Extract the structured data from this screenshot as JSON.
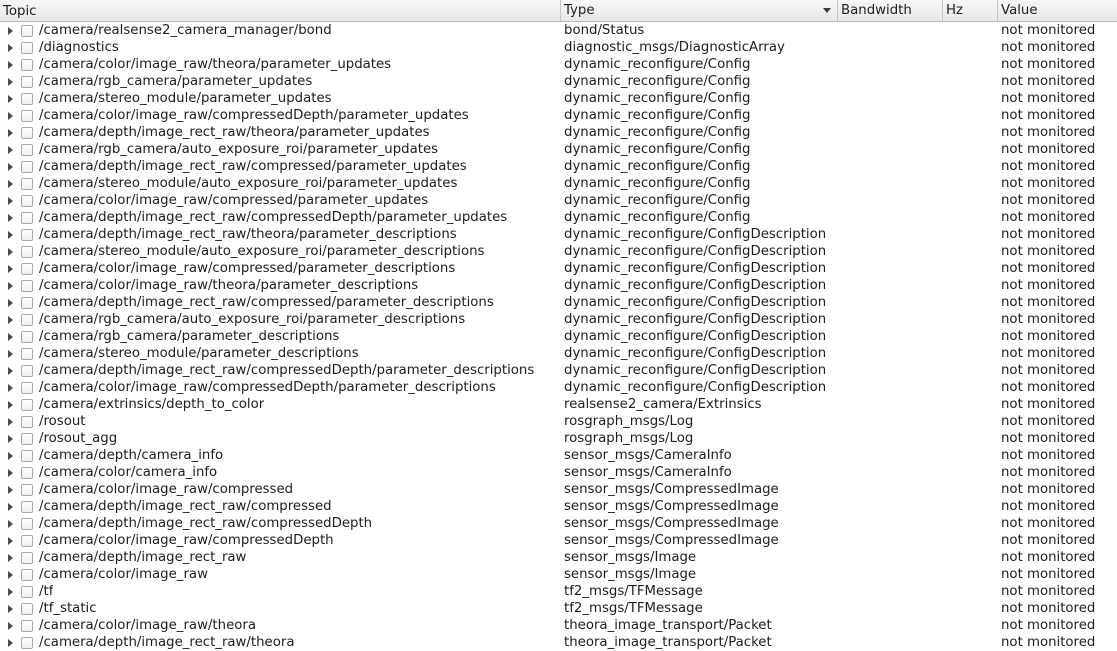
{
  "header": {
    "topic": "Topic",
    "type": "Type",
    "bandwidth": "Bandwidth",
    "hz": "Hz",
    "value": "Value"
  },
  "rows": [
    {
      "topic": "/camera/realsense2_camera_manager/bond",
      "type": "bond/Status",
      "value": "not monitored"
    },
    {
      "topic": "/diagnostics",
      "type": "diagnostic_msgs/DiagnosticArray",
      "value": "not monitored"
    },
    {
      "topic": "/camera/color/image_raw/theora/parameter_updates",
      "type": "dynamic_reconfigure/Config",
      "value": "not monitored"
    },
    {
      "topic": "/camera/rgb_camera/parameter_updates",
      "type": "dynamic_reconfigure/Config",
      "value": "not monitored"
    },
    {
      "topic": "/camera/stereo_module/parameter_updates",
      "type": "dynamic_reconfigure/Config",
      "value": "not monitored"
    },
    {
      "topic": "/camera/color/image_raw/compressedDepth/parameter_updates",
      "type": "dynamic_reconfigure/Config",
      "value": "not monitored"
    },
    {
      "topic": "/camera/depth/image_rect_raw/theora/parameter_updates",
      "type": "dynamic_reconfigure/Config",
      "value": "not monitored"
    },
    {
      "topic": "/camera/rgb_camera/auto_exposure_roi/parameter_updates",
      "type": "dynamic_reconfigure/Config",
      "value": "not monitored"
    },
    {
      "topic": "/camera/depth/image_rect_raw/compressed/parameter_updates",
      "type": "dynamic_reconfigure/Config",
      "value": "not monitored"
    },
    {
      "topic": "/camera/stereo_module/auto_exposure_roi/parameter_updates",
      "type": "dynamic_reconfigure/Config",
      "value": "not monitored"
    },
    {
      "topic": "/camera/color/image_raw/compressed/parameter_updates",
      "type": "dynamic_reconfigure/Config",
      "value": "not monitored"
    },
    {
      "topic": "/camera/depth/image_rect_raw/compressedDepth/parameter_updates",
      "type": "dynamic_reconfigure/Config",
      "value": "not monitored"
    },
    {
      "topic": "/camera/depth/image_rect_raw/theora/parameter_descriptions",
      "type": "dynamic_reconfigure/ConfigDescription",
      "value": "not monitored"
    },
    {
      "topic": "/camera/stereo_module/auto_exposure_roi/parameter_descriptions",
      "type": "dynamic_reconfigure/ConfigDescription",
      "value": "not monitored"
    },
    {
      "topic": "/camera/color/image_raw/compressed/parameter_descriptions",
      "type": "dynamic_reconfigure/ConfigDescription",
      "value": "not monitored"
    },
    {
      "topic": "/camera/color/image_raw/theora/parameter_descriptions",
      "type": "dynamic_reconfigure/ConfigDescription",
      "value": "not monitored"
    },
    {
      "topic": "/camera/depth/image_rect_raw/compressed/parameter_descriptions",
      "type": "dynamic_reconfigure/ConfigDescription",
      "value": "not monitored"
    },
    {
      "topic": "/camera/rgb_camera/auto_exposure_roi/parameter_descriptions",
      "type": "dynamic_reconfigure/ConfigDescription",
      "value": "not monitored"
    },
    {
      "topic": "/camera/rgb_camera/parameter_descriptions",
      "type": "dynamic_reconfigure/ConfigDescription",
      "value": "not monitored"
    },
    {
      "topic": "/camera/stereo_module/parameter_descriptions",
      "type": "dynamic_reconfigure/ConfigDescription",
      "value": "not monitored"
    },
    {
      "topic": "/camera/depth/image_rect_raw/compressedDepth/parameter_descriptions",
      "type": "dynamic_reconfigure/ConfigDescription",
      "value": "not monitored"
    },
    {
      "topic": "/camera/color/image_raw/compressedDepth/parameter_descriptions",
      "type": "dynamic_reconfigure/ConfigDescription",
      "value": "not monitored"
    },
    {
      "topic": "/camera/extrinsics/depth_to_color",
      "type": "realsense2_camera/Extrinsics",
      "value": "not monitored"
    },
    {
      "topic": "/rosout",
      "type": "rosgraph_msgs/Log",
      "value": "not monitored"
    },
    {
      "topic": "/rosout_agg",
      "type": "rosgraph_msgs/Log",
      "value": "not monitored"
    },
    {
      "topic": "/camera/depth/camera_info",
      "type": "sensor_msgs/CameraInfo",
      "value": "not monitored"
    },
    {
      "topic": "/camera/color/camera_info",
      "type": "sensor_msgs/CameraInfo",
      "value": "not monitored"
    },
    {
      "topic": "/camera/color/image_raw/compressed",
      "type": "sensor_msgs/CompressedImage",
      "value": "not monitored"
    },
    {
      "topic": "/camera/depth/image_rect_raw/compressed",
      "type": "sensor_msgs/CompressedImage",
      "value": "not monitored"
    },
    {
      "topic": "/camera/depth/image_rect_raw/compressedDepth",
      "type": "sensor_msgs/CompressedImage",
      "value": "not monitored"
    },
    {
      "topic": "/camera/color/image_raw/compressedDepth",
      "type": "sensor_msgs/CompressedImage",
      "value": "not monitored"
    },
    {
      "topic": "/camera/depth/image_rect_raw",
      "type": "sensor_msgs/Image",
      "value": "not monitored"
    },
    {
      "topic": "/camera/color/image_raw",
      "type": "sensor_msgs/Image",
      "value": "not monitored"
    },
    {
      "topic": "/tf",
      "type": "tf2_msgs/TFMessage",
      "value": "not monitored"
    },
    {
      "topic": "/tf_static",
      "type": "tf2_msgs/TFMessage",
      "value": "not monitored"
    },
    {
      "topic": "/camera/color/image_raw/theora",
      "type": "theora_image_transport/Packet",
      "value": "not monitored"
    },
    {
      "topic": "/camera/depth/image_rect_raw/theora",
      "type": "theora_image_transport/Packet",
      "value": "not monitored"
    }
  ]
}
